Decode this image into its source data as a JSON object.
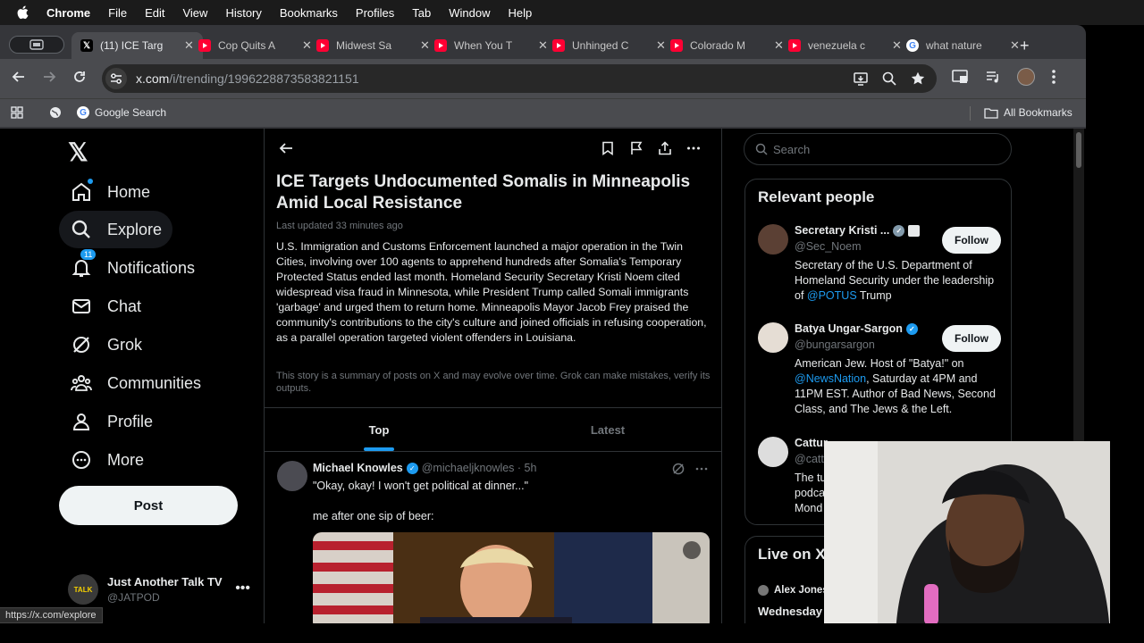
{
  "menubar": {
    "app": "Chrome",
    "items": [
      "File",
      "Edit",
      "View",
      "History",
      "Bookmarks",
      "Profiles",
      "Tab",
      "Window",
      "Help"
    ]
  },
  "tabs": [
    {
      "title": "(11) ICE Targ",
      "icon": "x-icon",
      "active": true
    },
    {
      "title": "Cop Quits A",
      "icon": "youtube-icon"
    },
    {
      "title": "Midwest Sa",
      "icon": "youtube-icon"
    },
    {
      "title": "When You T",
      "icon": "youtube-icon"
    },
    {
      "title": "Unhinged C",
      "icon": "youtube-icon"
    },
    {
      "title": "Colorado M",
      "icon": "youtube-icon"
    },
    {
      "title": "venezuela c",
      "icon": "youtube-icon"
    },
    {
      "title": "what nature",
      "icon": "google-icon"
    }
  ],
  "address": {
    "host": "x.com",
    "path": "/i/trending/1996228873583821151"
  },
  "bookmarks": {
    "google_search": "Google Search",
    "all_bookmarks": "All Bookmarks"
  },
  "nav": {
    "items": [
      "Home",
      "Explore",
      "Notifications",
      "Chat",
      "Grok",
      "Communities",
      "Profile",
      "More"
    ],
    "notifications_badge": "11",
    "post_label": "Post"
  },
  "account": {
    "name": "Just Another Talk TV",
    "handle": "@JATPOD",
    "avatar_text": "TALK"
  },
  "story": {
    "headline": "ICE Targets Undocumented Somalis in Minneapolis Amid Local Resistance",
    "updated": "Last updated 33 minutes ago",
    "summary": "U.S. Immigration and Customs Enforcement launched a major operation in the Twin Cities, involving over 100 agents to apprehend hundreds after Somalia's Temporary Protected Status ended last month. Homeland Security Secretary Kristi Noem cited widespread visa fraud in Minnesota, while President Trump called Somali immigrants 'garbage' and urged them to return home. Minneapolis Mayor Jacob Frey praised the community's contributions to the city's culture and joined officials in refusing cooperation, as a parallel operation targeted violent offenders in Louisiana.",
    "disclaimer": "This story is a summary of posts on X and may evolve over time. Grok can make mistakes, verify its outputs.",
    "tab_top": "Top",
    "tab_latest": "Latest"
  },
  "tweet": {
    "name": "Michael Knowles",
    "handle": "@michaeljknowles · 5h",
    "line1": "\"Okay, okay! I won't get political at dinner...\"",
    "line2": "me after one sip of beer:"
  },
  "right": {
    "search_placeholder": "Search",
    "relevant_title": "Relevant people",
    "follow_label": "Follow",
    "p1": {
      "name": "Secretary Kristi ...",
      "handle": "@Sec_Noem",
      "bio_a": "Secretary of the U.S. Department of Homeland Security under the leadership of ",
      "bio_link": "@POTUS",
      "bio_b": " Trump"
    },
    "p2": {
      "name": "Batya Ungar-Sargon",
      "handle": "@bungarsargon",
      "bio_a": "American Jew. Host of \"Batya!\" on ",
      "bio_link": "@NewsNation",
      "bio_b": ", Saturday at 4PM and 11PM EST. Author of Bad News, Second Class, and The Jews & the Left."
    },
    "p3": {
      "name": "Cattur...",
      "handle": "@catt",
      "bio": "The tu podca Mond"
    },
    "live_title": "Live on X",
    "live_host": "Alex Jones",
    "live_line": "Wednesday"
  },
  "status_url": "https://x.com/explore",
  "colors": {
    "accent": "#1d9bf0",
    "bg": "#000000",
    "text": "#e7e9ea",
    "muted": "#71767b"
  }
}
